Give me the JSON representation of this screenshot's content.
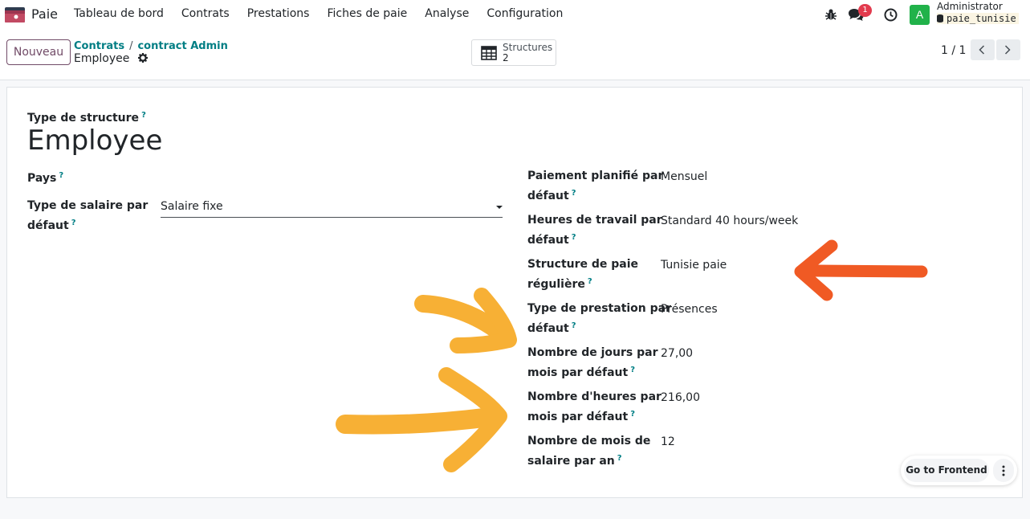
{
  "navbar": {
    "app_name": "Paie",
    "menu": [
      "Tableau de bord",
      "Contrats",
      "Prestations",
      "Fiches de paie",
      "Analyse",
      "Configuration"
    ],
    "notification_count": "1",
    "avatar_letter": "A",
    "user_name": "Administrator",
    "database": "paie_tunisie",
    "icons": [
      "payroll-app-icon",
      "bug-icon",
      "chat-icon",
      "clock-icon",
      "database-icon"
    ]
  },
  "control": {
    "new_button": "Nouveau",
    "breadcrumb": [
      "Contrats",
      "contract Admin"
    ],
    "record_name": "Employee",
    "smart_button": {
      "label": "Structures",
      "count": "2"
    },
    "pager": "1 / 1"
  },
  "form": {
    "title_label": "Type de structure",
    "title": "Employee",
    "help_mark": "?",
    "left_fields": [
      {
        "label": "Pays",
        "value": ""
      },
      {
        "label_line1": "Type de salaire par",
        "label_line2": "défaut",
        "value": "Salaire fixe"
      }
    ],
    "right_fields": [
      {
        "label_line1": "Paiement planifié par",
        "label_line2": "défaut",
        "value": "Mensuel"
      },
      {
        "label_line1": "Heures de travail par",
        "label_line2": "défaut",
        "value": "Standard 40 hours/week"
      },
      {
        "label_line1": "Structure de paie",
        "label_line2": "régulière",
        "value": "Tunisie paie"
      },
      {
        "label_line1": "Type de prestation par",
        "label_line2": "défaut",
        "value": "Présences"
      },
      {
        "label_line1": "Nombre de jours par",
        "label_line2": "mois par défaut",
        "value": "27,00"
      },
      {
        "label_line1": "Nombre d'heures par",
        "label_line2": "mois par défaut",
        "value": "216,00"
      },
      {
        "label_line1": "Nombre de mois de",
        "label_line2": "salaire par an",
        "value": "12"
      }
    ]
  },
  "frontend_button": "Go to Frontend",
  "colors": {
    "brand": "#714b67",
    "link": "#017e84",
    "orange_arrow": "#f05a24",
    "yellow_arrow": "#f7b035"
  }
}
